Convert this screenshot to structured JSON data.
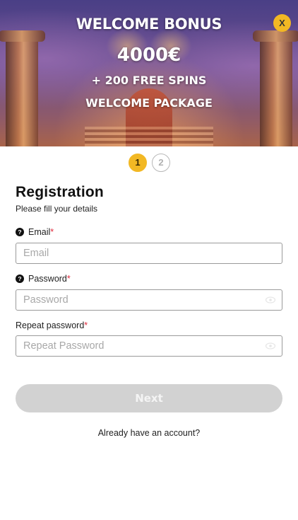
{
  "banner": {
    "title": "WELCOME BONUS",
    "amount": "4000€",
    "spins": "+ 200 FREE SPINS",
    "package": "WELCOME PACKAGE",
    "close_label": "X"
  },
  "steps": [
    "1",
    "2"
  ],
  "steps_active_index": 0,
  "form": {
    "title": "Registration",
    "subtitle": "Please fill your details",
    "email": {
      "label": "Email",
      "required_mark": "*",
      "placeholder": "Email",
      "help_icon": "?"
    },
    "password": {
      "label": "Password",
      "required_mark": "*",
      "placeholder": "Password",
      "help_icon": "?"
    },
    "repeat_password": {
      "label": "Repeat password",
      "required_mark": "*",
      "placeholder": "Repeat Password"
    },
    "next_label": "Next",
    "login_link": "Already have an account?"
  },
  "colors": {
    "accent": "#f2b824",
    "required": "#e0283b",
    "button_disabled": "#d2d2d2"
  },
  "icons": [
    "close-icon",
    "help-icon",
    "eye-icon"
  ]
}
